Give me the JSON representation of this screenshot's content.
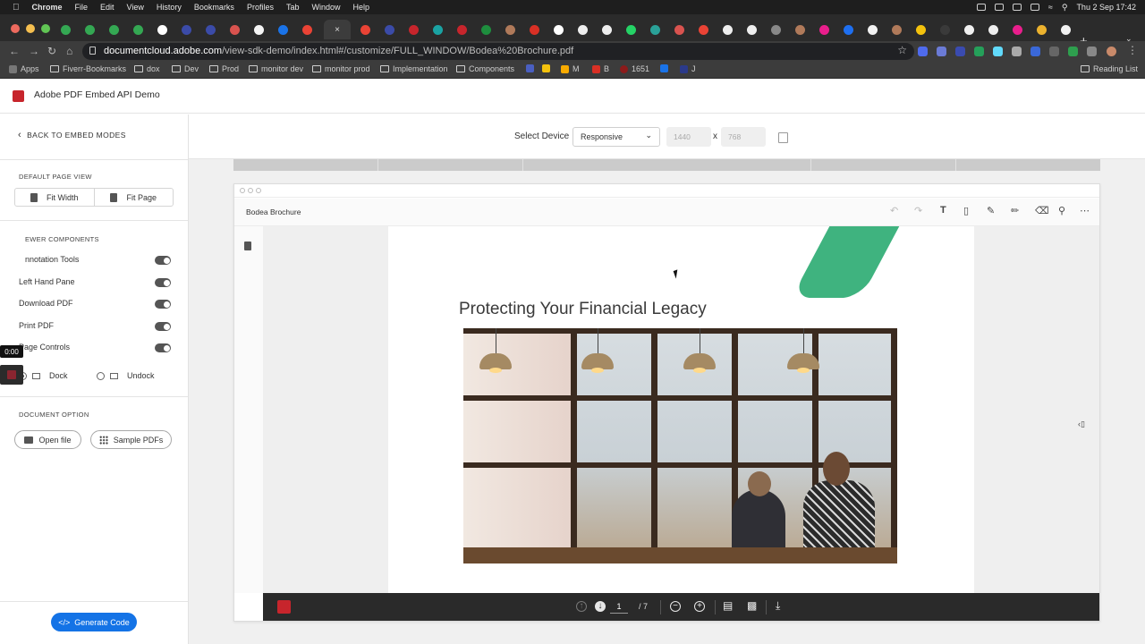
{
  "menubar": {
    "app": "Chrome",
    "items": [
      "File",
      "Edit",
      "View",
      "History",
      "Bookmarks",
      "Profiles",
      "Tab",
      "Window",
      "Help"
    ],
    "clock": "Thu 2 Sep  17:42"
  },
  "browser": {
    "url_host": "documentcloud.adobe.com",
    "url_path": "/view-sdk-demo/index.html#/customize/FULL_WINDOW/Bodea%20Brochure.pdf",
    "new_tab": "+",
    "bookmarks": [
      {
        "label": "Apps",
        "icon": "apps-grid-icon"
      },
      {
        "label": "Fiverr-Bookmarks",
        "icon": "folder-icon"
      },
      {
        "label": "dox",
        "icon": "folder-icon"
      },
      {
        "label": "Dev",
        "icon": "folder-icon"
      },
      {
        "label": "Prod",
        "icon": "folder-icon"
      },
      {
        "label": "monitor dev",
        "icon": "folder-icon"
      },
      {
        "label": "monitor prod",
        "icon": "folder-icon"
      },
      {
        "label": "Implementation",
        "icon": "folder-icon"
      },
      {
        "label": "Components",
        "icon": "folder-icon"
      },
      {
        "label": "M",
        "icon": "bookmark-icon"
      },
      {
        "label": "B",
        "icon": "bookmark-icon"
      },
      {
        "label": "1651",
        "icon": "bookmark-icon"
      },
      {
        "label": "J",
        "icon": "bookmark-icon"
      }
    ],
    "reading_list": "Reading List"
  },
  "app": {
    "title": "Adobe PDF Embed API Demo"
  },
  "sidebar": {
    "back_label": "BACK TO EMBED MODES",
    "default_view_header": "DEFAULT PAGE VIEW",
    "fit_width": "Fit Width",
    "fit_page": "Fit Page",
    "viewer_components_header": "EWER COMPONENTS",
    "toggles": [
      {
        "label": "nnotation Tools",
        "on": true
      },
      {
        "label": "Left Hand Pane",
        "on": true
      },
      {
        "label": "Download PDF",
        "on": true
      },
      {
        "label": "Print PDF",
        "on": true
      },
      {
        "label": "Page Controls",
        "on": true
      }
    ],
    "dock_label": "Dock",
    "undock_label": "Undock",
    "document_option_header": "DOCUMENT OPTION",
    "open_file": "Open file",
    "sample_pdfs": "Sample PDFs",
    "generate_code": "Generate Code",
    "recording_time": "0:00"
  },
  "device": {
    "label": "Select Device",
    "selected": "Responsive",
    "width": "1440",
    "x_label": "x",
    "height": "768"
  },
  "viewer": {
    "doc_name": "Bodea Brochure",
    "page_title": "Protecting Your Financial Legacy",
    "current_page": "1",
    "total_pages": "/ 7"
  },
  "colors": {
    "adobe_red": "#c7252c",
    "accent_blue": "#1473e6",
    "brochure_green": "#3fb37f"
  }
}
